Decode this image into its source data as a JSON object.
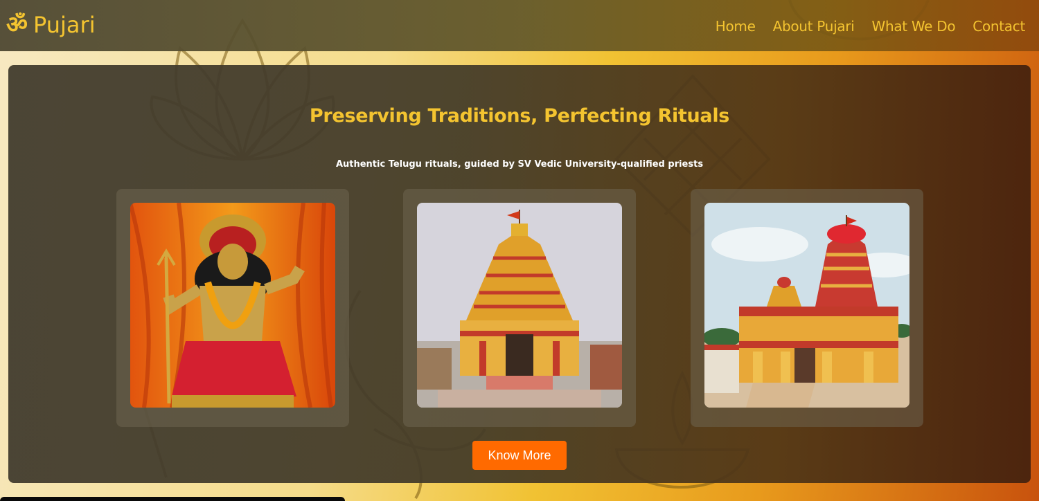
{
  "header": {
    "logo_symbol": "ॐ",
    "brand": "Pujari",
    "nav": [
      "Home",
      "About Pujari",
      "What We Do",
      "Contact"
    ]
  },
  "hero": {
    "title": "Preserving Traditions, Perfecting Rituals",
    "subtitle": "Authentic Telugu rituals, guided by SV Vedic University-qualified priests",
    "cards": [
      {
        "image": "deity-statue-image"
      },
      {
        "image": "temple-gopuram-image"
      },
      {
        "image": "temple-complex-image"
      }
    ],
    "button_label": "Know More"
  },
  "colors": {
    "accent": "#f4c430",
    "button": "#ff6a00"
  }
}
